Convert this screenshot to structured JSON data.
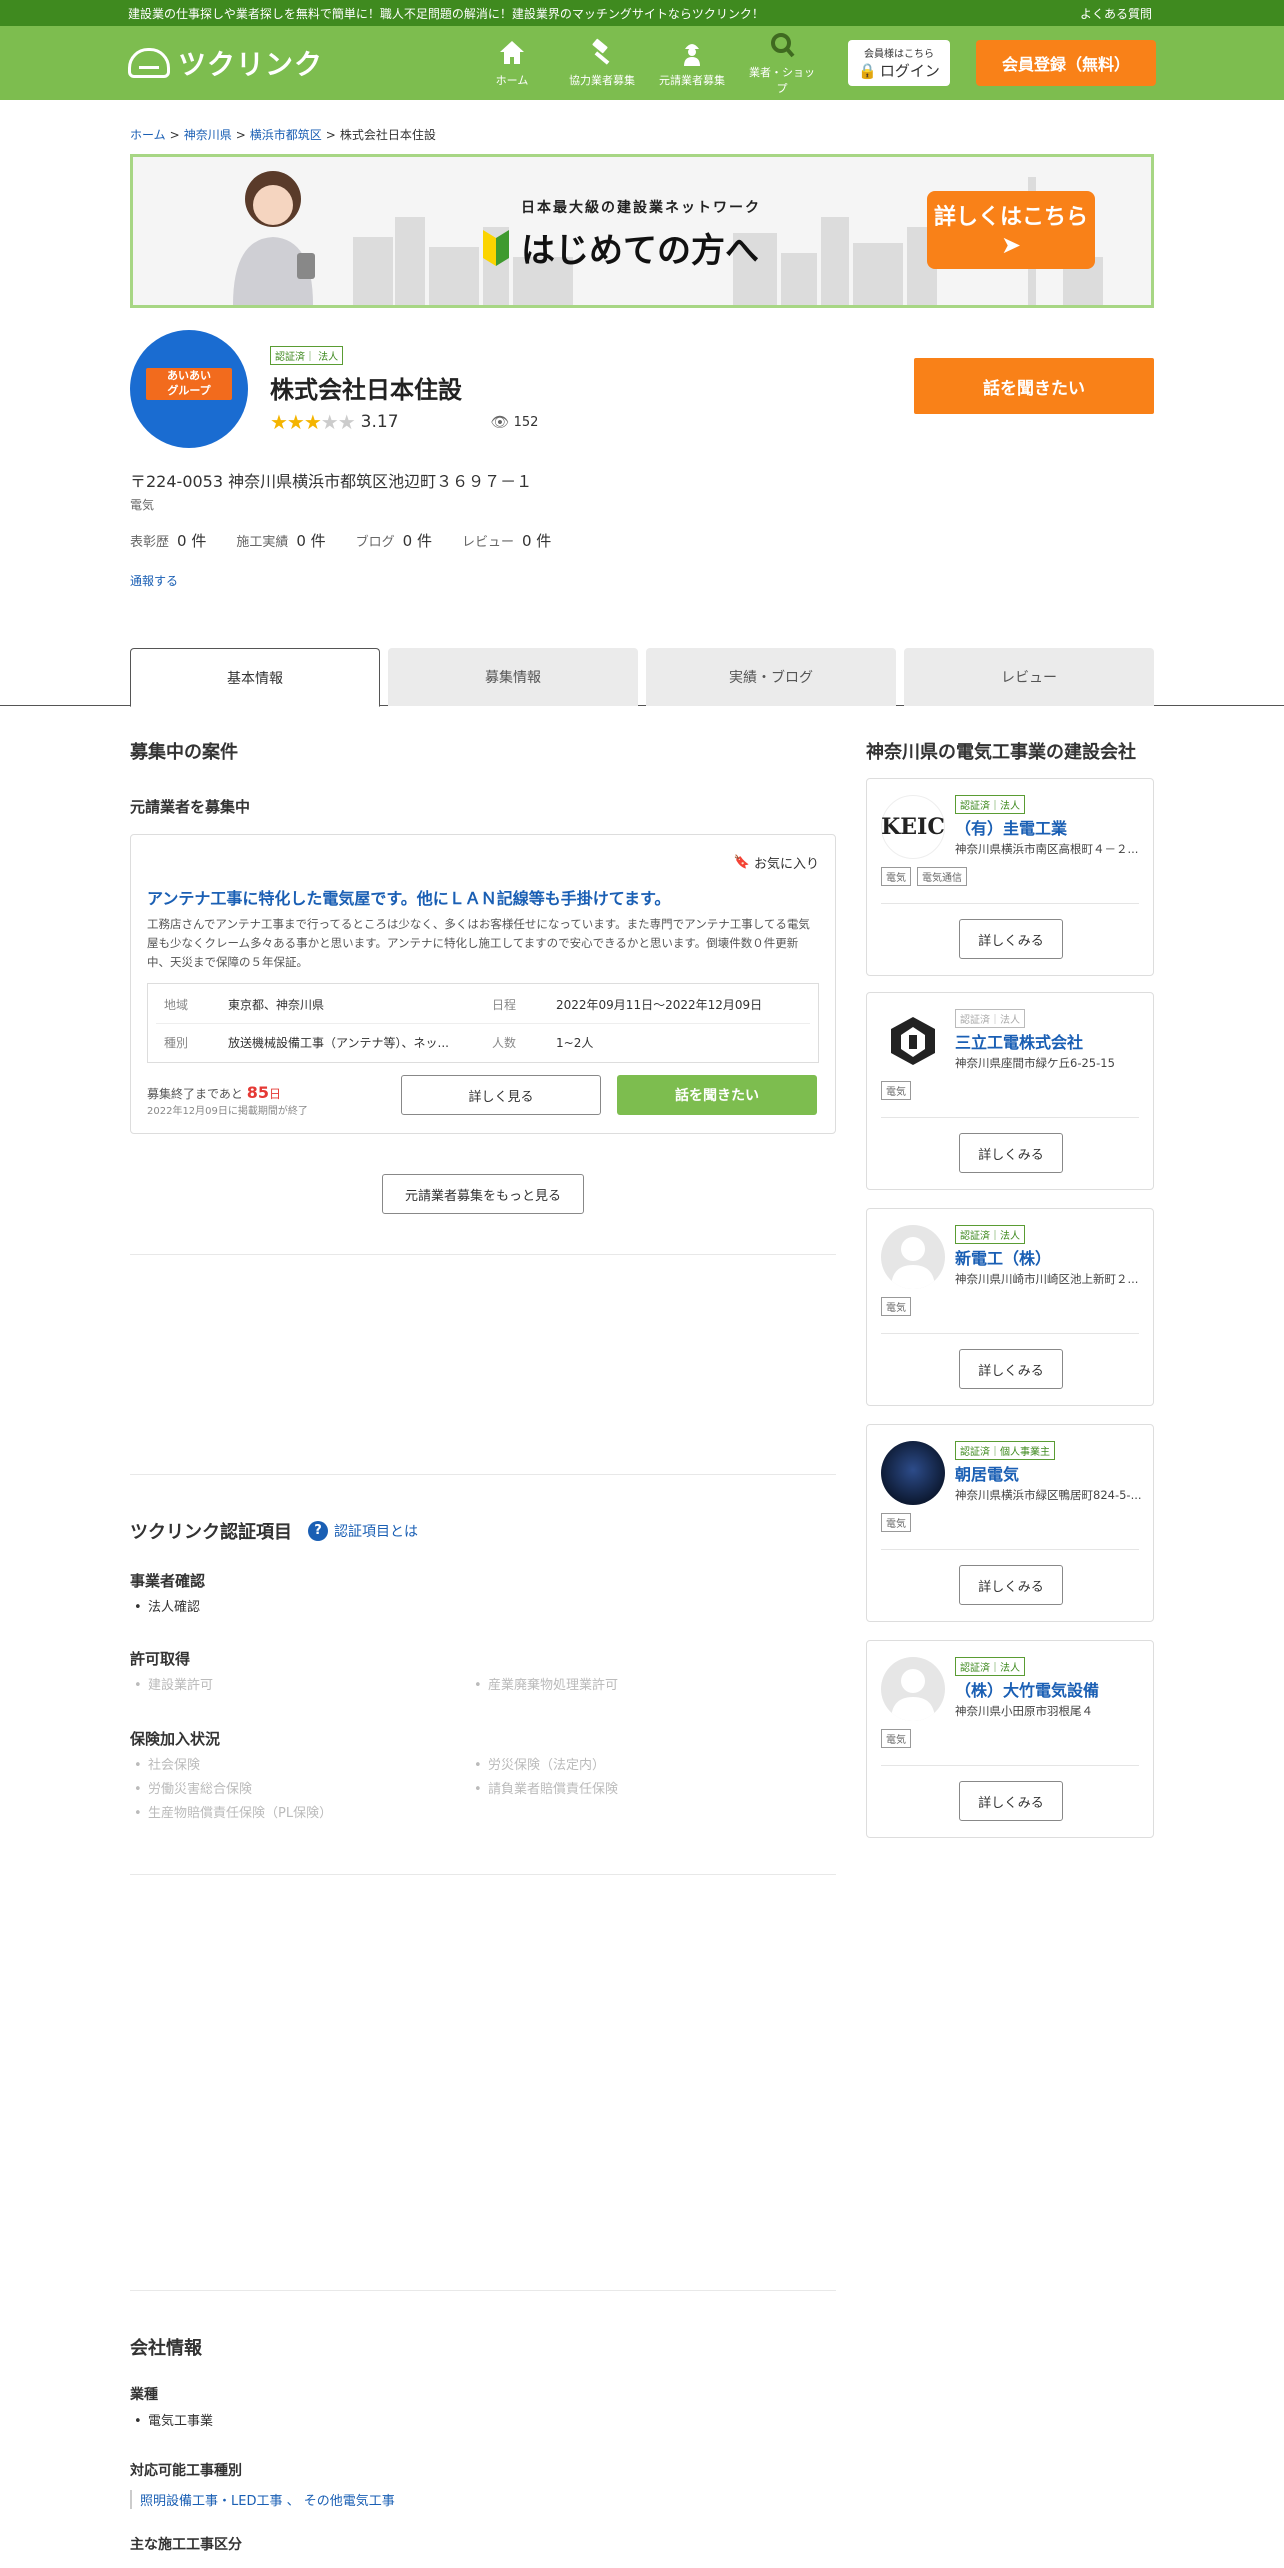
{
  "topbar": {
    "tagline": "建設業の仕事探しや業者探しを無料で簡単に！職人不足問題の解消に！建設業界のマッチングサイトならツクリンク！",
    "faq": "よくある質問"
  },
  "header": {
    "logo": "ツクリンク",
    "nav": [
      {
        "label": "ホーム",
        "icon": "home-icon"
      },
      {
        "label": "協力業者募集",
        "icon": "hammer-icon"
      },
      {
        "label": "元請業者募集",
        "icon": "worker-icon"
      },
      {
        "label": "業者・ショップ",
        "icon": "search-icon"
      }
    ],
    "login_small": "会員様はこちら",
    "login_label": "ログイン",
    "register_label": "会員登録（無料）"
  },
  "breadcrumb": [
    "ホーム",
    "神奈川県",
    "横浜市都筑区",
    "株式会社日本住設"
  ],
  "banner": {
    "tag": "日本最大級の建設業ネットワーク",
    "headline": "はじめての方へ",
    "cta": "詳しくはこちら"
  },
  "company": {
    "logo_text_1": "あいあい",
    "logo_text_2": "グループ",
    "badge": "認証済｜ 法人",
    "name": "株式会社日本住設",
    "rating": "3.17",
    "rating_stars": 3,
    "views": "152",
    "talk_label": "話を聞きたい",
    "address": "〒224-0053 神奈川県横浜市都筑区池辺町３６９７－１",
    "industry": "電気",
    "counts": [
      {
        "label": "表彰歴",
        "value": "0 件"
      },
      {
        "label": "施工実績",
        "value": "0 件"
      },
      {
        "label": "ブログ",
        "value": "0 件"
      },
      {
        "label": "レビュー",
        "value": "0 件"
      }
    ],
    "report": "通報する"
  },
  "tabs": [
    "基本情報",
    "募集情報",
    "実績・ブログ",
    "レビュー"
  ],
  "recruit": {
    "heading": "募集中の案件",
    "subheading": "元請業者を募集中",
    "job": {
      "favorite": "お気に入り",
      "title": "アンテナ工事に特化した電気屋です。他にＬＡＮ記線等も手掛けてます。",
      "description": "工務店さんでアンテナ工事まで行ってるところは少なく、多くはお客様任せになっています。また専門でアンテナ工事してる電気屋も少なくクレーム多々ある事かと思います。アンテナに特化し施工してますので安心できるかと思います。倒壊件数０件更新中、天災まで保障の５年保証。",
      "area_label": "地域",
      "area": "東京都、神奈川県",
      "date_label": "日程",
      "date": "2022年09月11日〜2022年12月09日",
      "kind_label": "種別",
      "kind": "放送機械設備工事（アンテナ等）、ネッ...",
      "people_label": "人数",
      "people": "1~2人",
      "deadline_prefix": "募集終了まであと",
      "deadline_days": "85",
      "deadline_unit": "日",
      "deadline_note": "2022年12月09日に掲載期間が終了",
      "detail_label": "詳しく見る",
      "talk_label": "話を聞きたい"
    },
    "more_label": "元請業者募集をもっと見る"
  },
  "cert": {
    "heading": "ツクリンク認証項目",
    "help": "認証項目とは",
    "groups": [
      {
        "title": "事業者確認",
        "items": [
          {
            "label": "法人確認",
            "on": true
          }
        ]
      },
      {
        "title": "許可取得",
        "items": [
          {
            "label": "建設業許可",
            "on": false
          },
          {
            "label": "産業廃棄物処理業許可",
            "on": false
          }
        ]
      },
      {
        "title": "保険加入状況",
        "items": [
          {
            "label": "社会保険",
            "on": false
          },
          {
            "label": "労災保険（法定内）",
            "on": false
          },
          {
            "label": "労働災害総合保険",
            "on": false
          },
          {
            "label": "請負業者賠償責任保険",
            "on": false
          },
          {
            "label": "生産物賠償責任保険（PL保険）",
            "on": false
          }
        ]
      }
    ]
  },
  "company_info": {
    "heading": "会社情報",
    "industry_label": "業種",
    "industry_items": [
      "電気工事業"
    ],
    "work_types_label": "対応可能工事種別",
    "work_types": "照明設備工事・LED工事 、 その他電気工事",
    "main_work_label": "主な施工工事区分"
  },
  "sidebar": {
    "heading": "神奈川県の電気工事業の建設会社",
    "more_label": "詳しくみる",
    "companies": [
      {
        "badge": "認証済｜法人",
        "badge_on": true,
        "name": "（有）圭電工業",
        "address": "神奈川県横浜市南区高根町４－２...",
        "tags": [
          "電気",
          "電気通信"
        ],
        "logo": "keic"
      },
      {
        "badge": "認証済｜法人",
        "badge_on": false,
        "name": "三立工電株式会社",
        "address": "神奈川県座間市緑ケ丘6-25-15",
        "tags": [
          "電気"
        ],
        "logo": "mark"
      },
      {
        "badge": "認証済｜法人",
        "badge_on": true,
        "name": "新電工（株）",
        "address": "神奈川県川崎市川崎区池上新町２...",
        "tags": [
          "電気"
        ],
        "logo": "person"
      },
      {
        "badge": "認証済｜個人事業主",
        "badge_on": true,
        "name": "朝居電気",
        "address": "神奈川県横浜市緑区鴨居町824-5-...",
        "tags": [
          "電気"
        ],
        "logo": "dark"
      },
      {
        "badge": "認証済｜法人",
        "badge_on": true,
        "name": "（株）大竹電気設備",
        "address": "神奈川県小田原市羽根尾４",
        "tags": [
          "電気"
        ],
        "logo": "person"
      }
    ]
  },
  "colors": {
    "brand_green": "#7dbd4f",
    "dark_green": "#3f8a1f",
    "orange": "#f98118",
    "link": "#1a5fb4"
  }
}
